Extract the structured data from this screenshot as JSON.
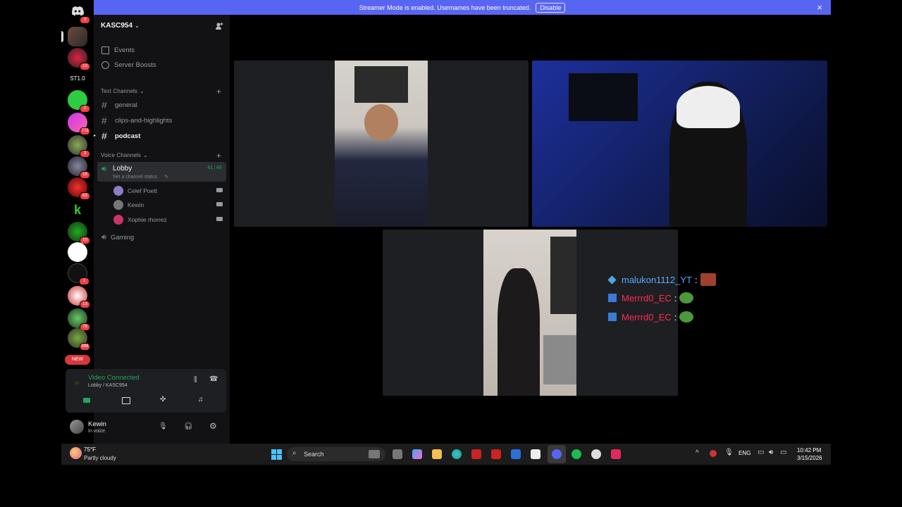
{
  "banner": {
    "text": "Streamer Mode is enabled. Usernames have been truncated.",
    "disable_label": "Disable",
    "close_icon": "×"
  },
  "rail": {
    "home_badge": "2",
    "badges": [
      "13",
      "2",
      "773",
      "3",
      "18",
      "63",
      "10",
      "1",
      "13",
      "76",
      "888"
    ],
    "st_label": "ST1.0",
    "new_label": "NEW"
  },
  "server": {
    "name": "KASC954"
  },
  "menu": {
    "events": "Events",
    "boosts": "Server Boosts"
  },
  "text_category": "Text Channels",
  "text_channels": [
    "general",
    "clips-and-highlights",
    "podcast"
  ],
  "voice_category": "Voice Channels",
  "lobby": {
    "name": "Lobby",
    "timer": "41:46",
    "status": "Set a channel status"
  },
  "voice_users": [
    "Celef Poett",
    "Kewin",
    "Xophie rhorrez"
  ],
  "gaming": {
    "name": "Gaming"
  },
  "connection": {
    "title": "Video Connected",
    "subtitle": "Lobby / KASC954"
  },
  "user": {
    "name": "Kewin",
    "status": "In voice"
  },
  "chat": [
    {
      "name": "malukon1112_YT",
      "color": "#5aa8ff"
    },
    {
      "name": "Merrrd0_EC",
      "color": "#ff2b4f"
    },
    {
      "name": "Merrrd0_EC",
      "color": "#ff2b4f"
    }
  ],
  "chat_sep": ":",
  "taskbar": {
    "weather_temp": "75°F",
    "weather_desc": "Partly cloudy",
    "search_label": "Search",
    "lang": "ENG",
    "time": "10:42 PM",
    "date": "3/15/2026"
  },
  "colors": {
    "accent": "#5865f2",
    "green": "#23a55a",
    "red": "#f23f43"
  }
}
